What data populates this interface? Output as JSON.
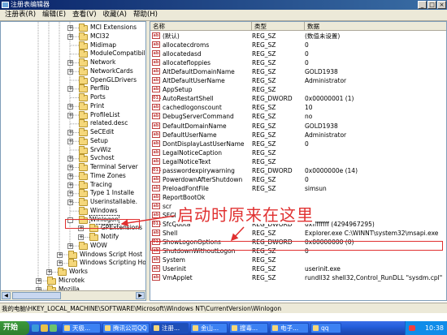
{
  "window": {
    "title": "注册表编辑器",
    "controls": {
      "min": "_",
      "max": "□",
      "close": "×"
    }
  },
  "menu": [
    "注册表(R)",
    "编辑(E)",
    "查看(V)",
    "收藏(A)",
    "帮助(H)"
  ],
  "tree": {
    "items": [
      {
        "label": "MCI Extensions",
        "level": 0,
        "expander": "+"
      },
      {
        "label": "MCI32",
        "level": 0,
        "expander": "+"
      },
      {
        "label": "Midimap",
        "level": 0,
        "expander": ""
      },
      {
        "label": "ModuleCompatibili",
        "level": 0,
        "expander": ""
      },
      {
        "label": "Network",
        "level": 0,
        "expander": "+"
      },
      {
        "label": "NetworkCards",
        "level": 0,
        "expander": "+"
      },
      {
        "label": "OpenGLDrivers",
        "level": 0,
        "expander": ""
      },
      {
        "label": "Perflib",
        "level": 0,
        "expander": "+"
      },
      {
        "label": "Ports",
        "level": 0,
        "expander": ""
      },
      {
        "label": "Print",
        "level": 0,
        "expander": "+"
      },
      {
        "label": "ProfileList",
        "level": 0,
        "expander": "+"
      },
      {
        "label": "related.desc",
        "level": 0,
        "expander": ""
      },
      {
        "label": "SeCEdit",
        "level": 0,
        "expander": "+"
      },
      {
        "label": "Setup",
        "level": 0,
        "expander": "+"
      },
      {
        "label": "SrvWiz",
        "level": 0,
        "expander": ""
      },
      {
        "label": "Svchost",
        "level": 0,
        "expander": "+"
      },
      {
        "label": "Terminal Server",
        "level": 0,
        "expander": "+"
      },
      {
        "label": "Time Zones",
        "level": 0,
        "expander": "+"
      },
      {
        "label": "Tracing",
        "level": 0,
        "expander": "+"
      },
      {
        "label": "Type 1 Installe",
        "level": 0,
        "expander": "+"
      },
      {
        "label": "Userinstallable.",
        "level": 0,
        "expander": "+"
      },
      {
        "label": "Windows",
        "level": 0,
        "expander": ""
      },
      {
        "label": "Winlogon",
        "level": 0,
        "expander": "-"
      },
      {
        "label": "GPExtensions",
        "level": 1,
        "expander": "+"
      },
      {
        "label": "Notify",
        "level": 1,
        "expander": "+"
      },
      {
        "label": "WOW",
        "level": 0,
        "expander": "+"
      },
      {
        "label": "Windows Script Host",
        "level": -1,
        "expander": "+"
      },
      {
        "label": "Windows Scripting Host",
        "level": -1,
        "expander": "+"
      },
      {
        "label": "Works",
        "level": -2,
        "expander": "+"
      },
      {
        "label": "Microtek",
        "level": -3,
        "expander": "+"
      },
      {
        "label": "Mozilla",
        "level": -3,
        "expander": "+"
      }
    ]
  },
  "list": {
    "columns": {
      "name": "名称",
      "type": "类型",
      "data": "数据"
    },
    "rows": [
      {
        "name": "(默认)",
        "type": "REG_SZ",
        "data": "(数值未设置)",
        "icon": "ab"
      },
      {
        "name": "allocatecdroms",
        "type": "REG_SZ",
        "data": "0",
        "icon": "ab"
      },
      {
        "name": "allocatedasd",
        "type": "REG_SZ",
        "data": "0",
        "icon": "ab"
      },
      {
        "name": "allocatefloppies",
        "type": "REG_SZ",
        "data": "0",
        "icon": "ab"
      },
      {
        "name": "AltDefaultDomainName",
        "type": "REG_SZ",
        "data": "GOLD1938",
        "icon": "ab"
      },
      {
        "name": "AltDefaultUserName",
        "type": "REG_SZ",
        "data": "Administrator",
        "icon": "ab"
      },
      {
        "name": "AppSetup",
        "type": "REG_SZ",
        "data": "",
        "icon": "ab"
      },
      {
        "name": "AutoRestartShell",
        "type": "REG_DWORD",
        "data": "0x00000001 (1)",
        "icon": "01"
      },
      {
        "name": "cachedlogonscount",
        "type": "REG_SZ",
        "data": "10",
        "icon": "ab"
      },
      {
        "name": "DebugServerCommand",
        "type": "REG_SZ",
        "data": "no",
        "icon": "ab"
      },
      {
        "name": "DefaultDomainName",
        "type": "REG_SZ",
        "data": "GOLD1938",
        "icon": "ab"
      },
      {
        "name": "DefaultUserName",
        "type": "REG_SZ",
        "data": "Administrator",
        "icon": "ab"
      },
      {
        "name": "DontDisplayLastUserName",
        "type": "REG_SZ",
        "data": "0",
        "icon": "ab"
      },
      {
        "name": "LegalNoticeCaption",
        "type": "REG_SZ",
        "data": "",
        "icon": "ab"
      },
      {
        "name": "LegalNoticeText",
        "type": "REG_SZ",
        "data": "",
        "icon": "ab"
      },
      {
        "name": "passwordexpirywarning",
        "type": "REG_DWORD",
        "data": "0x0000000e (14)",
        "icon": "01"
      },
      {
        "name": "PowerdownAfterShutdown",
        "type": "REG_SZ",
        "data": "0",
        "icon": "ab"
      },
      {
        "name": "PreloadFontFile",
        "type": "REG_SZ",
        "data": "simsun",
        "icon": "ab"
      },
      {
        "name": "ReportBootOk",
        "type": "",
        "data": "",
        "icon": "ab"
      },
      {
        "name": "scr",
        "type": "",
        "data": "",
        "icon": "ab"
      },
      {
        "name": "SFCI",
        "type": "",
        "data": "",
        "icon": "ab"
      },
      {
        "name": "SfcQuota",
        "type": "REG_DWORD",
        "data": "0xffffffff (4294967295)",
        "icon": "01"
      },
      {
        "name": "Shell",
        "type": "REG_SZ",
        "data": "Explorer.exe C:\\WINNT\\system32\\msapi.exe",
        "icon": "ab"
      },
      {
        "name": "ShowLogonOptions",
        "type": "REG_DWORD",
        "data": "0x00000000 (0)",
        "icon": "01"
      },
      {
        "name": "ShutdownWithoutLogon",
        "type": "REG_SZ",
        "data": "0",
        "icon": "ab"
      },
      {
        "name": "System",
        "type": "REG_SZ",
        "data": "",
        "icon": "ab"
      },
      {
        "name": "Userinit",
        "type": "REG_SZ",
        "data": "userinit.exe",
        "icon": "ab"
      },
      {
        "name": "VmApplet",
        "type": "REG_SZ",
        "data": "rundll32 shell32,Control_RunDLL \"sysdm.cpl\"",
        "icon": "ab"
      }
    ]
  },
  "annotation": "启动时原来在这里",
  "statusbar": "我的电脑\\HKEY_LOCAL_MACHINE\\SOFTWARE\\Microsoft\\Windows NT\\CurrentVersion\\Winlogon",
  "taskbar": {
    "start": "开始",
    "tasks": [
      {
        "label": "天极...",
        "active": false
      },
      {
        "label": "腾讯公司QQ",
        "active": false
      },
      {
        "label": "注册...",
        "active": true
      },
      {
        "label": "金山...",
        "active": false
      },
      {
        "label": "搜毒...",
        "active": false
      },
      {
        "label": "电子...",
        "active": false
      },
      {
        "label": "qq",
        "active": false
      }
    ],
    "clock": "10:38"
  },
  "colors": {
    "highlight": "#e03030",
    "title_bar": "#0a246a",
    "taskbar": "#245edb"
  }
}
